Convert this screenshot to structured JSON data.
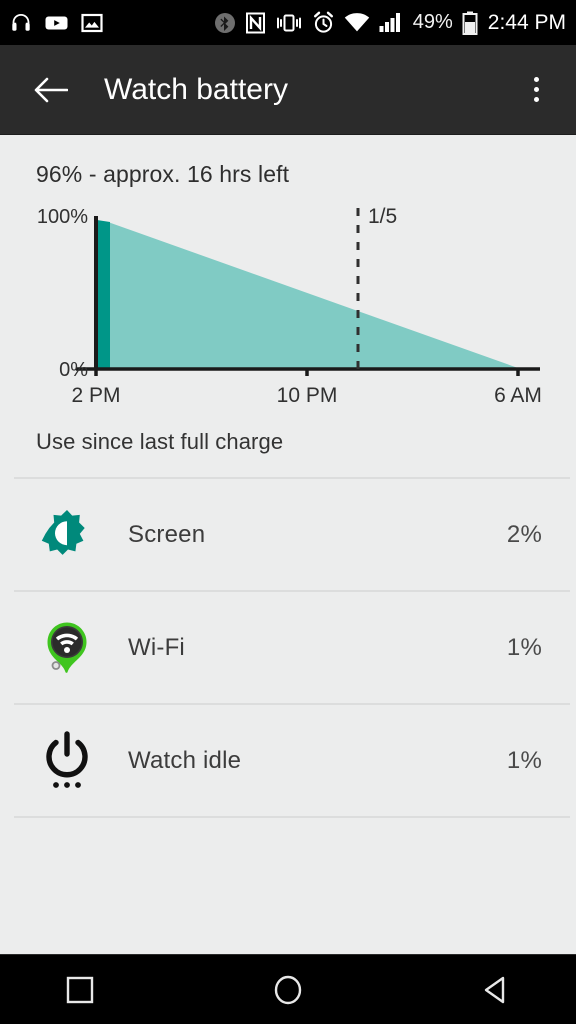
{
  "status_bar": {
    "left_icons": [
      "headphones-icon",
      "youtube-icon",
      "photo-icon"
    ],
    "right_icons": [
      "bluetooth-icon",
      "nfc-icon",
      "vibrate-icon",
      "alarm-icon",
      "wifi-icon",
      "signal-icon"
    ],
    "battery_percent": "49%",
    "battery_icon": "battery-icon",
    "time": "2:44 PM"
  },
  "app_bar": {
    "back_icon": "back-arrow-icon",
    "title": "Watch battery",
    "overflow_icon": "overflow-menu-icon"
  },
  "main": {
    "summary": "96% - approx. 16 hrs left",
    "section_label": "Use since last full charge"
  },
  "chart_data": {
    "type": "area",
    "title": "96% - approx. 16 hrs left",
    "xlabel": "",
    "ylabel": "",
    "ylim": [
      0,
      100
    ],
    "y_tick_labels": [
      "100%",
      "0%"
    ],
    "y_ticks": [
      100,
      0
    ],
    "x_tick_labels": [
      "2 PM",
      "10 PM",
      "6 AM"
    ],
    "x_ticks": [
      0,
      8,
      16
    ],
    "x_unit": "hours from 2 PM",
    "xlim": [
      0,
      16
    ],
    "grid": false,
    "legend": "none",
    "series": [
      {
        "name": "Battery history",
        "color": "#009688",
        "x": [
          0,
          0.55
        ],
        "values": [
          100,
          97
        ]
      },
      {
        "name": "Projected battery",
        "color": "#80cbc4",
        "x": [
          0.55,
          16
        ],
        "values": [
          97,
          0
        ]
      }
    ],
    "annotations": [
      {
        "name": "date-marker",
        "label": "1/5",
        "x": 10,
        "style": "dashed-vertical-line",
        "color": "#303030"
      }
    ],
    "axis_color": "#1a1a1a"
  },
  "usage_list": {
    "rows": [
      {
        "icon": "brightness-icon",
        "label": "Screen",
        "value": "2%"
      },
      {
        "icon": "wifi-badge-icon",
        "label": "Wi-Fi",
        "value": "1%"
      },
      {
        "icon": "power-idle-icon",
        "label": "Watch idle",
        "value": "1%"
      }
    ]
  },
  "nav_bar": {
    "recents_icon": "recents-square-icon",
    "home_icon": "home-circle-icon",
    "back_icon": "back-triangle-icon"
  },
  "colors": {
    "accent_dark": "#009688",
    "accent_light": "#80cbc4",
    "background": "#eceded",
    "app_bar": "#2b2b2b",
    "wifi_green": "#3fc51f"
  }
}
